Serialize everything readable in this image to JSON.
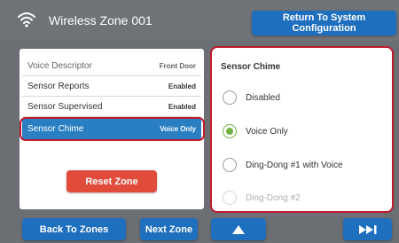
{
  "header": {
    "title": "Wireless Zone 001",
    "wifi_icon": "wifi-icon",
    "return_label": "Return To System Configuration"
  },
  "settings": {
    "rows": [
      {
        "label": "Voice Descriptor",
        "value": "Front Door"
      },
      {
        "label": "Sensor Reports",
        "value": "Enabled"
      },
      {
        "label": "Sensor Supervised",
        "value": "Enabled"
      },
      {
        "label": "Sensor Chime",
        "value": "Voice Only"
      }
    ],
    "selected_index": 3,
    "reset_label": "Reset Zone"
  },
  "chime_panel": {
    "title": "Sensor Chime",
    "options": [
      {
        "label": "Disabled",
        "selected": false
      },
      {
        "label": "Voice Only",
        "selected": true
      },
      {
        "label": "Ding-Dong #1 with Voice",
        "selected": false
      },
      {
        "label": "Ding-Dong #2",
        "selected": false
      }
    ]
  },
  "footer": {
    "back_label": "Back To Zones",
    "next_label": "Next Zone",
    "up_icon": "triangle-up-icon",
    "fast_forward_icon": "fast-forward-icon"
  },
  "colors": {
    "background": "#6b6e72",
    "button_blue": "#1f6fbf",
    "selected_row": "#2a7fc2",
    "reset_red": "#e04b3a",
    "highlight_red": "#c01a2e",
    "radio_green": "#6fb23f"
  }
}
